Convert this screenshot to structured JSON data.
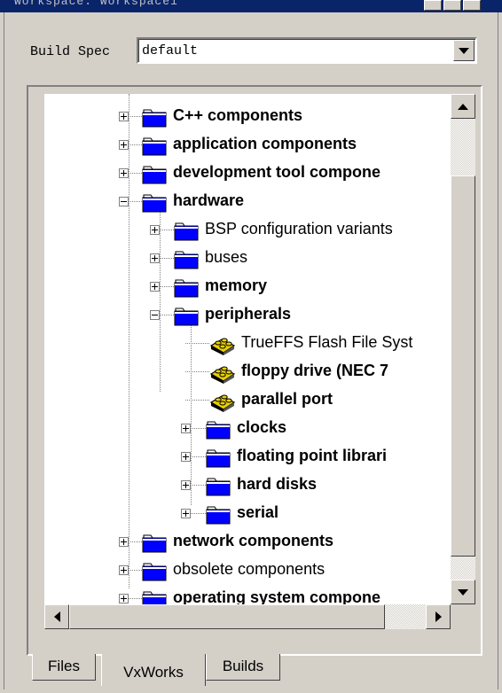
{
  "window": {
    "title": "Workspace: Workspace1"
  },
  "build_spec": {
    "label": "Build Spec",
    "value": "default"
  },
  "tree": {
    "items": [
      {
        "label": "C++ components",
        "bold": true,
        "expander": "plus",
        "icon": "folder-icon"
      },
      {
        "label": "application components",
        "bold": true,
        "expander": "plus",
        "icon": "folder-icon"
      },
      {
        "label": "development tool compone",
        "bold": true,
        "expander": "plus",
        "icon": "folder-icon"
      },
      {
        "label": "hardware",
        "bold": true,
        "expander": "minus",
        "icon": "folder-icon"
      },
      {
        "label": "BSP configuration variants",
        "bold": false,
        "expander": "plus",
        "icon": "folder-icon"
      },
      {
        "label": "buses",
        "bold": false,
        "expander": "plus",
        "icon": "folder-icon"
      },
      {
        "label": "memory",
        "bold": true,
        "expander": "plus",
        "icon": "folder-icon"
      },
      {
        "label": "peripherals",
        "bold": true,
        "expander": "minus",
        "icon": "folder-icon"
      },
      {
        "label": "TrueFFS Flash File Syst",
        "bold": false,
        "expander": "none",
        "icon": "component-icon"
      },
      {
        "label": "floppy drive (NEC 7",
        "bold": true,
        "expander": "none",
        "icon": "component-icon"
      },
      {
        "label": "parallel port",
        "bold": true,
        "expander": "none",
        "icon": "component-icon"
      },
      {
        "label": "clocks",
        "bold": true,
        "expander": "plus",
        "icon": "folder-icon"
      },
      {
        "label": "floating point librari",
        "bold": true,
        "expander": "plus",
        "icon": "folder-icon"
      },
      {
        "label": "hard disks",
        "bold": true,
        "expander": "plus",
        "icon": "folder-icon"
      },
      {
        "label": "serial",
        "bold": true,
        "expander": "plus",
        "icon": "folder-icon"
      },
      {
        "label": "network components",
        "bold": true,
        "expander": "plus",
        "icon": "folder-icon"
      },
      {
        "label": "obsolete components",
        "bold": false,
        "expander": "plus",
        "icon": "folder-icon"
      },
      {
        "label": "operating system compone",
        "bold": true,
        "expander": "plus",
        "icon": "folder-icon"
      }
    ]
  },
  "tabs": [
    {
      "label": "Files",
      "active": false
    },
    {
      "label": "VxWorks",
      "active": true
    },
    {
      "label": "Builds",
      "active": false
    }
  ],
  "colors": {
    "folder": "#0000ff",
    "component": "#e8d000",
    "face": "#d4d0c8",
    "titlebar": "#0a246a"
  }
}
